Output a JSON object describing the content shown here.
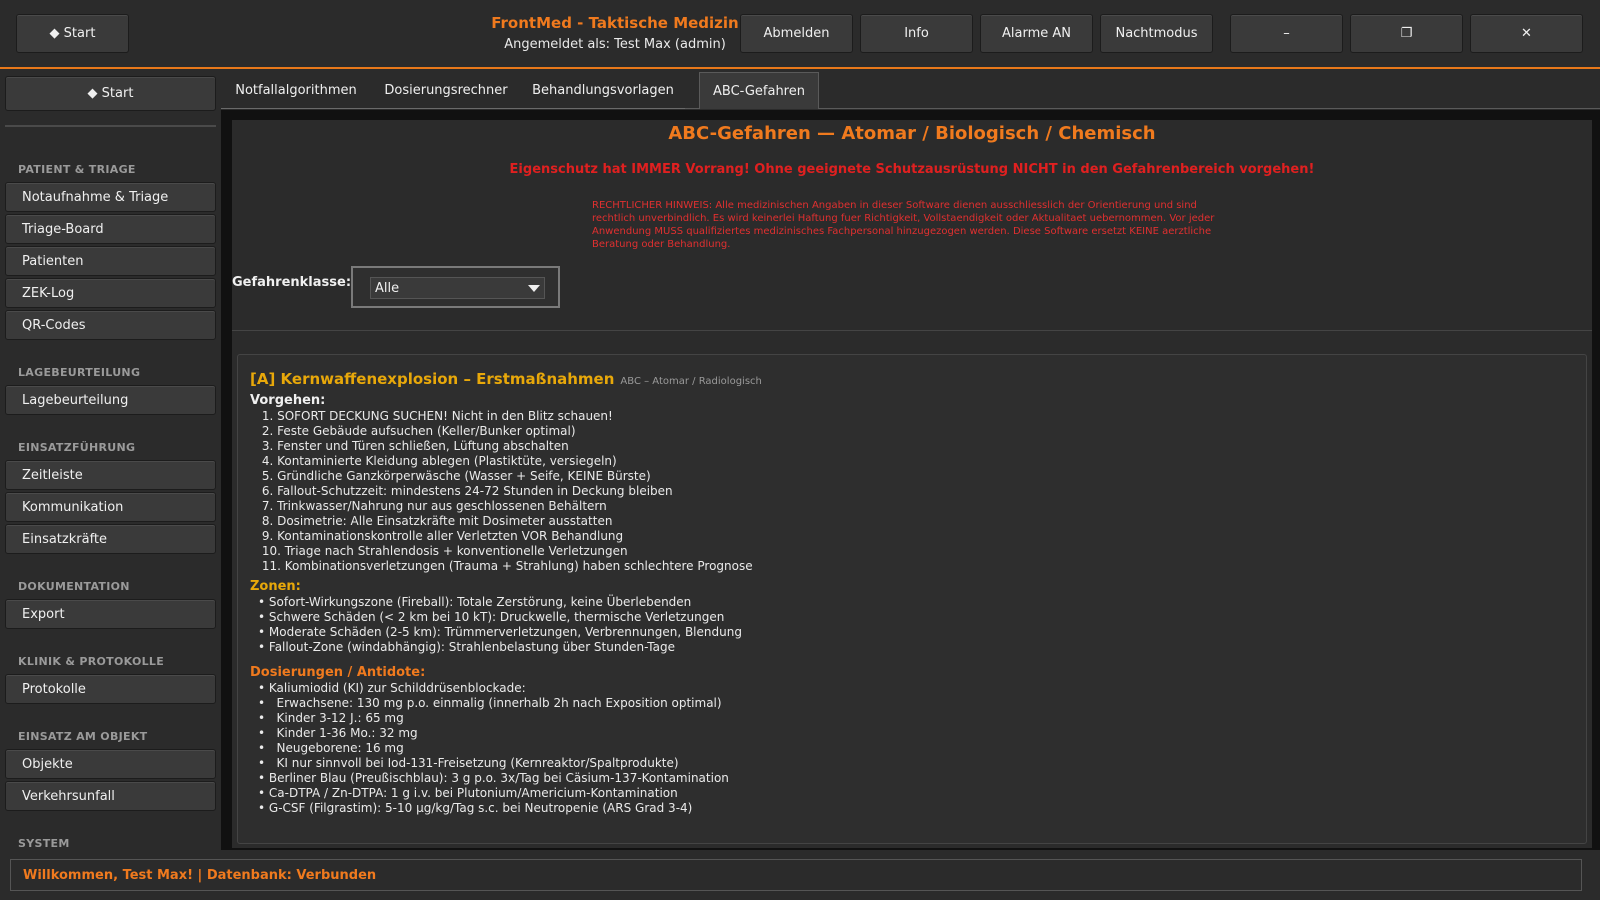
{
  "header": {
    "start_label": "◆  Start",
    "app_title": "FrontMed - Taktische Medizin",
    "user_line": "Angemeldet als: Test Max (admin)",
    "buttons": [
      "Abmelden",
      "Info",
      "Alarme AN",
      "Nachtmodus"
    ],
    "window_controls": {
      "minimize": "–",
      "maximize": "❐",
      "close": "✕"
    },
    "accent_color": "#f07a1e"
  },
  "sidebar": {
    "start_label": "◆  Start",
    "sections": [
      {
        "title": "PATIENT & TRIAGE",
        "items": [
          "Notaufnahme & Triage",
          "Triage-Board",
          "Patienten",
          "ZEK-Log",
          "QR-Codes"
        ]
      },
      {
        "title": "LAGEBEURTEILUNG",
        "items": [
          "Lagebeurteilung"
        ]
      },
      {
        "title": "EINSATZFÜHRUNG",
        "items": [
          "Zeitleiste",
          "Kommunikation",
          "Einsatzkräfte"
        ]
      },
      {
        "title": "DOKUMENTATION",
        "items": [
          "Export"
        ]
      },
      {
        "title": "KLINIK & PROTOKOLLE",
        "items": [
          "Protokolle"
        ]
      },
      {
        "title": "EINSATZ AM OBJEKT",
        "items": [
          "Objekte",
          "Verkehrsunfall"
        ]
      },
      {
        "title": "SYSTEM",
        "items": []
      }
    ]
  },
  "tabs": [
    {
      "label": "Notfallalgorithmen",
      "active": false
    },
    {
      "label": "Dosierungsrechner",
      "active": false
    },
    {
      "label": "Behandlungsvorlagen",
      "active": false
    },
    {
      "label": "ABC-Gefahren",
      "active": true
    }
  ],
  "main": {
    "title": "ABC-Gefahren — Atomar / Biologisch / Chemisch",
    "warning": "Eigenschutz hat IMMER Vorrang! Ohne geeignete Schutzausrüstung NICHT in den Gefahrenbereich vorgehen!",
    "legal_notice": "RECHTLICHER HINWEIS: Alle medizinischen Angaben in dieser Software dienen ausschliesslich der Orientierung und sind rechtlich unverbindlich. Es wird keinerlei Haftung fuer Richtigkeit, Vollstaendigkeit oder Aktualitaet uebernommen. Vor jeder Anwendung MUSS qualifiziertes medizinisches Fachpersonal hinzugezogen werden. Diese Software ersetzt KEINE aerztliche Beratung oder Behandlung.",
    "filter": {
      "label": "Gefahrenklasse:",
      "selected": "Alle"
    },
    "card": {
      "title": "[A] Kernwaffenexplosion – Erstmaßnahmen",
      "category": "ABC – Atomar / Radiologisch",
      "procedure_heading": "Vorgehen:",
      "procedure": [
        " 1. SOFORT DECKUNG SUCHEN! Nicht in den Blitz schauen!",
        " 2. Feste Gebäude aufsuchen (Keller/Bunker optimal)",
        " 3. Fenster und Türen schließen, Lüftung abschalten",
        " 4. Kontaminierte Kleidung ablegen (Plastiktüte, versiegeln)",
        " 5. Gründliche Ganzkörperwäsche (Wasser + Seife, KEINE Bürste)",
        " 6. Fallout-Schutzzeit: mindestens 24-72 Stunden in Deckung bleiben",
        " 7. Trinkwasser/Nahrung nur aus geschlossenen Behältern",
        " 8. Dosimetrie: Alle Einsatzkräfte mit Dosimeter ausstatten",
        " 9. Kontaminationskontrolle aller Verletzten VOR Behandlung",
        " 10. Triage nach Strahlendosis + konventionelle Verletzungen",
        " 11. Kombinationsverletzungen (Trauma + Strahlung) haben schlechtere Prognose"
      ],
      "zones_heading": "Zonen:",
      "zones": [
        "• Sofort-Wirkungszone (Fireball): Totale Zerstörung, keine Überlebenden",
        "• Schwere Schäden (< 2 km bei 10 kT): Druckwelle, thermische Verletzungen",
        "• Moderate Schäden (2-5 km): Trümmerverletzungen, Verbrennungen, Blendung",
        "• Fallout-Zone (windabhängig): Strahlenbelastung über Stunden-Tage"
      ],
      "dosing_heading": "Dosierungen / Antidote:",
      "dosing": [
        "• Kaliumiodid (KI) zur Schilddrüsenblockade:",
        "•   Erwachsene: 130 mg p.o. einmalig (innerhalb 2h nach Exposition optimal)",
        "•   Kinder 3-12 J.: 65 mg",
        "•   Kinder 1-36 Mo.: 32 mg",
        "•   Neugeborene: 16 mg",
        "•   KI nur sinnvoll bei Iod-131-Freisetzung (Kernreaktor/Spaltprodukte)",
        "• Berliner Blau (Preußischblau): 3 g p.o. 3x/Tag bei Cäsium-137-Kontamination",
        "• Ca-DTPA / Zn-DTPA: 1 g i.v. bei Plutonium/Americium-Kontamination",
        "• G-CSF (Filgrastim): 5-10 µg/kg/Tag s.c. bei Neutropenie (ARS Grad 3-4)"
      ]
    }
  },
  "status": {
    "text": "Willkommen, Test Max! | Datenbank: Verbunden"
  }
}
